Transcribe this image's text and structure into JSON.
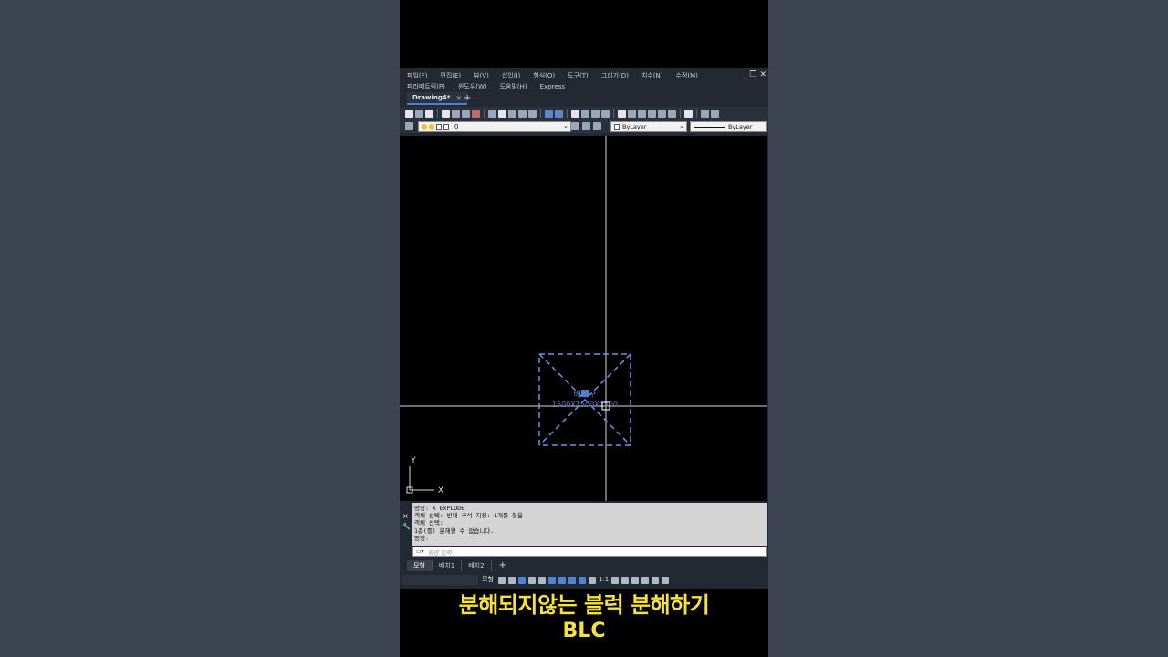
{
  "menubar": {
    "row1": [
      "파일(F)",
      "편집(E)",
      "뷰(V)",
      "삽입(I)",
      "형식(O)",
      "도구(T)",
      "그리기(D)",
      "치수(N)",
      "수정(M)"
    ],
    "row2": [
      "파라메트릭(P)",
      "윈도우(W)",
      "도움말(H)",
      "Express"
    ],
    "minimize": "_",
    "restore": "❐",
    "close": "✕"
  },
  "tabs": {
    "document": "Drawing4*",
    "close": "×",
    "new": "+"
  },
  "layer_toolbar": {
    "current_layer": "0",
    "color": "ByLayer",
    "linetype": "ByLayer",
    "arrow": "⌄"
  },
  "drawing": {
    "block_label_top": "배수구",
    "block_label_size": "1500X1500X1500",
    "ucs_y": "Y",
    "ucs_x": "X"
  },
  "command": {
    "history": [
      "명령: X EXPLODE",
      "객체 선택: 반대 구석 지정: 1개를 찾음",
      "객체 선택:",
      "1층(를) 분해할 수 없습니다.",
      "명령:"
    ],
    "placeholder": "명령 입력",
    "close_icon": "×",
    "wrench_icon": "🔧"
  },
  "layout_tabs": [
    "모형",
    "배치1",
    "배치2"
  ],
  "layout_add": "+",
  "statusbar": {
    "model": "모형",
    "scale": "1:1"
  },
  "caption": {
    "line1": "분해되지않는 블럭 분해하기",
    "line2": "BLC"
  },
  "colors": {
    "accent": "#4d7fd6",
    "block": "#6a93e8",
    "caption": "#f6e23c"
  }
}
